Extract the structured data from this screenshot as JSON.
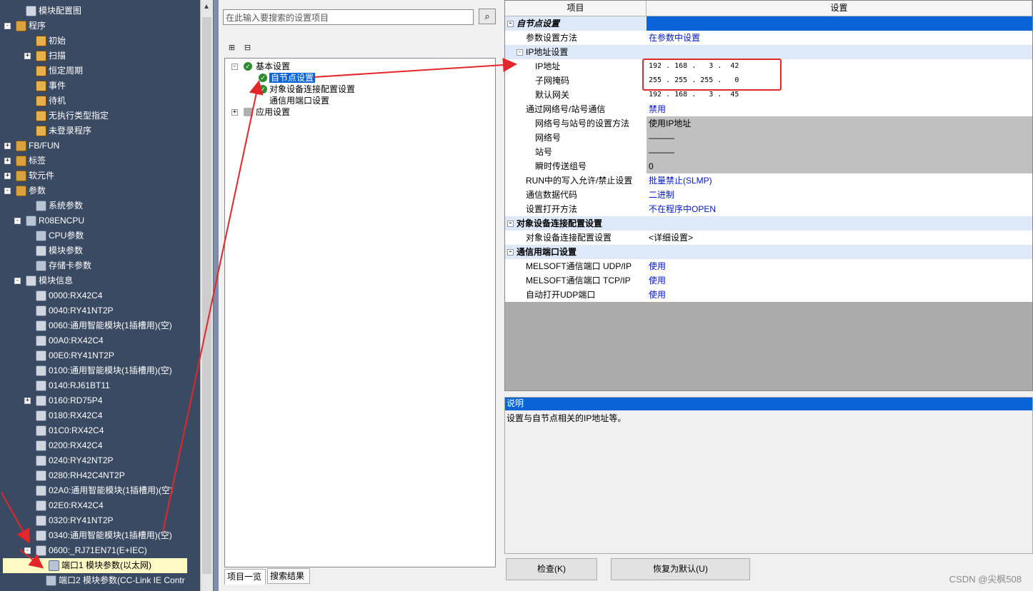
{
  "nav": {
    "items": [
      {
        "label": "模块配置图",
        "exp": "",
        "icon": "module-config-icon"
      },
      {
        "label": "程序",
        "exp": "-",
        "icon": "program-folder-icon"
      },
      {
        "label": "初始",
        "exp": "",
        "icon": "program-icon"
      },
      {
        "label": "扫描",
        "exp": "+",
        "icon": "program-icon"
      },
      {
        "label": "恒定周期",
        "exp": "",
        "icon": "program-icon"
      },
      {
        "label": "事件",
        "exp": "",
        "icon": "program-icon"
      },
      {
        "label": "待机",
        "exp": "",
        "icon": "program-icon"
      },
      {
        "label": "无执行类型指定",
        "exp": "",
        "icon": "program-icon"
      },
      {
        "label": "未登录程序",
        "exp": "",
        "icon": "program-icon"
      },
      {
        "label": "FB/FUN",
        "exp": "+",
        "icon": "fb-folder-icon"
      },
      {
        "label": "标签",
        "exp": "+",
        "icon": "label-folder-icon"
      },
      {
        "label": "软元件",
        "exp": "+",
        "icon": "device-folder-icon"
      },
      {
        "label": "参数",
        "exp": "-",
        "icon": "parameter-folder-icon"
      },
      {
        "label": "系统参数",
        "exp": "",
        "icon": "system-param-icon"
      },
      {
        "label": "R08ENCPU",
        "exp": "-",
        "icon": "cpu-icon"
      },
      {
        "label": "CPU参数",
        "exp": "",
        "icon": "cpu-param-icon"
      },
      {
        "label": "模块参数",
        "exp": "",
        "icon": "module-param-icon"
      },
      {
        "label": "存储卡参数",
        "exp": "",
        "icon": "memory-card-icon"
      },
      {
        "label": "模块信息",
        "exp": "-",
        "icon": "module-info-icon"
      },
      {
        "label": "0000:RX42C4",
        "exp": "",
        "icon": "module-icon"
      },
      {
        "label": "0040:RY41NT2P",
        "exp": "",
        "icon": "module-icon"
      },
      {
        "label": "0060:通用智能模块(1插槽用)(空)",
        "exp": "",
        "icon": "module-empty-icon"
      },
      {
        "label": "00A0:RX42C4",
        "exp": "",
        "icon": "module-icon"
      },
      {
        "label": "00E0:RY41NT2P",
        "exp": "",
        "icon": "module-icon"
      },
      {
        "label": "0100:通用智能模块(1插槽用)(空)",
        "exp": "",
        "icon": "module-empty-icon"
      },
      {
        "label": "0140:RJ61BT11",
        "exp": "",
        "icon": "module-icon"
      },
      {
        "label": "0160:RD75P4",
        "exp": "+",
        "icon": "module-icon"
      },
      {
        "label": "0180:RX42C4",
        "exp": "",
        "icon": "module-icon"
      },
      {
        "label": "01C0:RX42C4",
        "exp": "",
        "icon": "module-icon"
      },
      {
        "label": "0200:RX42C4",
        "exp": "",
        "icon": "module-icon"
      },
      {
        "label": "0240:RY42NT2P",
        "exp": "",
        "icon": "module-icon"
      },
      {
        "label": "0280:RH42C4NT2P",
        "exp": "",
        "icon": "module-icon"
      },
      {
        "label": "02A0:通用智能模块(1插槽用)(空)",
        "exp": "",
        "icon": "module-empty-icon"
      },
      {
        "label": "02E0:RX42C4",
        "exp": "",
        "icon": "module-icon"
      },
      {
        "label": "0320:RY41NT2P",
        "exp": "",
        "icon": "module-icon"
      },
      {
        "label": "0340:通用智能模块(1插槽用)(空)",
        "exp": "",
        "icon": "module-empty-icon"
      },
      {
        "label": "0600:_RJ71EN71(E+IEC)",
        "exp": "-",
        "icon": "module-icon"
      },
      {
        "label": "端口1 模块参数(以太网)",
        "exp": "",
        "icon": "port-param-icon",
        "selected": true
      },
      {
        "label": "端口2 模块参数(CC-Link IE Contr",
        "exp": "",
        "icon": "port-param-icon"
      }
    ]
  },
  "search": {
    "placeholder": "在此输入要搜索的设置项目",
    "button_icon": "binoculars-icon"
  },
  "toolbar": {
    "expand_icon": "expand-all-icon",
    "collapse_icon": "collapse-all-icon"
  },
  "settings_tree": {
    "basic": "基本设置",
    "own_node": "自节点设置",
    "target_conn": "对象设备连接配置设置",
    "general_port": "通信用端口设置",
    "app": "应用设置"
  },
  "tabs": {
    "items": "项目一览",
    "results": "搜索结果"
  },
  "grid": {
    "header_item": "项目",
    "header_setting": "设置",
    "rows": [
      {
        "label": "自节点设置",
        "value": "",
        "kind": "cat-hl"
      },
      {
        "label": "参数设置方法",
        "value": "在参数中设置",
        "kind": "blue"
      },
      {
        "label": "IP地址设置",
        "value": "",
        "kind": "sub"
      },
      {
        "label": "IP地址",
        "value": "192 . 168 .   3 .  42",
        "kind": "ip"
      },
      {
        "label": "子网掩码",
        "value": "255 . 255 . 255 .   0",
        "kind": "ip"
      },
      {
        "label": "默认网关",
        "value": "192 . 168 .   3 .  45",
        "kind": "ip"
      },
      {
        "label": "通过网络号/站号通信",
        "value": "禁用",
        "kind": "blue"
      },
      {
        "label": "网络号与站号的设置方法",
        "value": "使用IP地址",
        "kind": "gray"
      },
      {
        "label": "网络号",
        "value": "———",
        "kind": "gray"
      },
      {
        "label": "站号",
        "value": "———",
        "kind": "gray"
      },
      {
        "label": "瞬时传送组号",
        "value": "0",
        "kind": "gray"
      },
      {
        "label": "RUN中的写入允许/禁止设置",
        "value": "批量禁止(SLMP)",
        "kind": "blue"
      },
      {
        "label": "通信数据代码",
        "value": "二进制",
        "kind": "blue"
      },
      {
        "label": "设置打开方法",
        "value": "不在程序中OPEN",
        "kind": "blue"
      },
      {
        "label": "对象设备连接配置设置",
        "value": "",
        "kind": "cat"
      },
      {
        "label": "对象设备连接配置设置",
        "value": "<详细设置>",
        "kind": "black"
      },
      {
        "label": "通信用端口设置",
        "value": "",
        "kind": "cat"
      },
      {
        "label": "MELSOFT通信端口 UDP/IP",
        "value": "使用",
        "kind": "blue"
      },
      {
        "label": "MELSOFT通信端口 TCP/IP",
        "value": "使用",
        "kind": "blue"
      },
      {
        "label": "自动打开UDP端口",
        "value": "使用",
        "kind": "blue"
      }
    ]
  },
  "description": {
    "title": "说明",
    "text": "设置与自节点相关的IP地址等。"
  },
  "buttons": {
    "check": "检查(K)",
    "restore": "恢复为默认(U)"
  },
  "watermark": "CSDN @尖枫508",
  "colors": {
    "nav_bg": "#3a4a63",
    "selection": "#0a64d8",
    "annotation_red": "#e3262a",
    "value_blue": "#0018c8"
  }
}
